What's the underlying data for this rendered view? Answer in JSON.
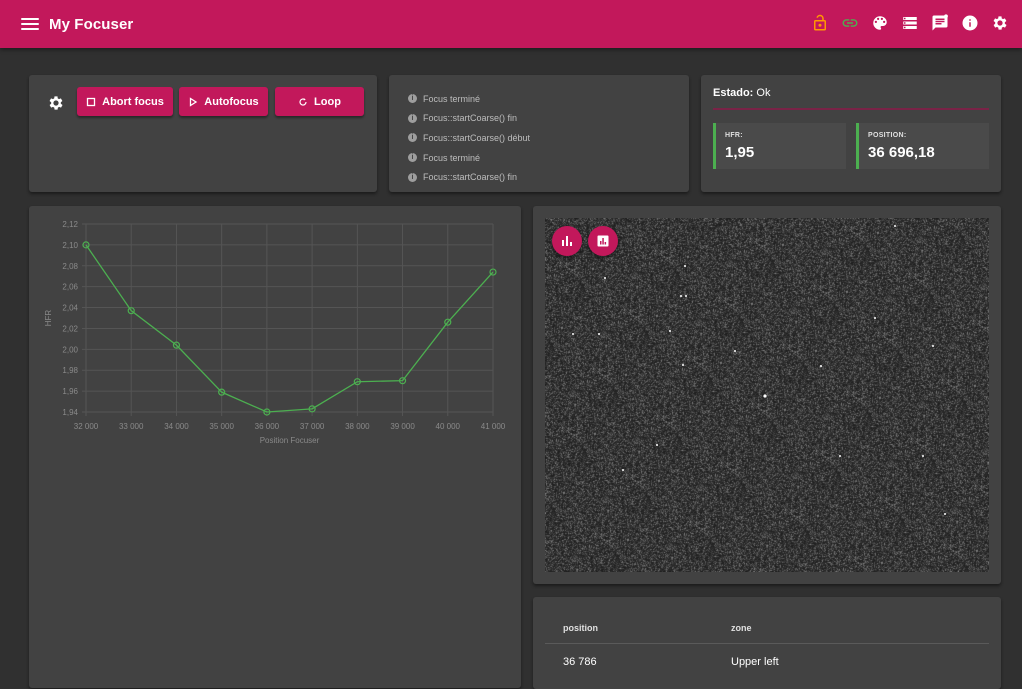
{
  "app": {
    "title": "My Focuser",
    "toolbar_icons": [
      "lock-open-icon",
      "link-icon",
      "palette-icon",
      "list-icon",
      "message-icon",
      "info-icon",
      "settings-icon"
    ],
    "accent_color": "#c2185b",
    "lock_color": "#ff9800",
    "link_color": "#4caf50"
  },
  "controls": {
    "abort_label": "Abort focus",
    "autofocus_label": "Autofocus",
    "loop_label": "Loop"
  },
  "log": {
    "messages": [
      "Focus terminé",
      "Focus::startCoarse() fin",
      "Focus::startCoarse() début",
      "Focus terminé",
      "Focus::startCoarse() fin"
    ]
  },
  "status": {
    "label": "Estado:",
    "value": "Ok",
    "hfr_label": "HFR:",
    "hfr_value": "1,95",
    "position_label": "POSITION:",
    "position_value": "36 696,18",
    "tile_color": "#4caf50"
  },
  "chart_data": {
    "type": "line",
    "xlabel": "Position Focuser",
    "ylabel": "HFR",
    "x": [
      32000,
      33000,
      34000,
      35000,
      36000,
      37000,
      38000,
      39000,
      40000,
      41000
    ],
    "values": [
      2.1,
      2.037,
      2.004,
      1.959,
      1.94,
      1.943,
      1.969,
      1.97,
      2.026,
      2.074
    ],
    "x_ticks": [
      "32 000",
      "33 000",
      "34 000",
      "35 000",
      "36 000",
      "37 000",
      "38 000",
      "39 000",
      "40 000",
      "41 000"
    ],
    "y_ticks": [
      "1,94",
      "1,96",
      "1,98",
      "2,00",
      "2,02",
      "2,04",
      "2,06",
      "2,08",
      "2,10",
      "2,12"
    ],
    "xlim": [
      32000,
      41000
    ],
    "ylim": [
      1.94,
      2.12
    ],
    "grid": true,
    "line_color": "#4caf50"
  },
  "image_tools": {
    "histogram_icon": "bar-chart-icon",
    "stats_icon": "analytics-icon"
  },
  "table": {
    "headers": [
      "position",
      "zone"
    ],
    "rows": [
      [
        "36 786",
        "Upper left"
      ]
    ]
  }
}
